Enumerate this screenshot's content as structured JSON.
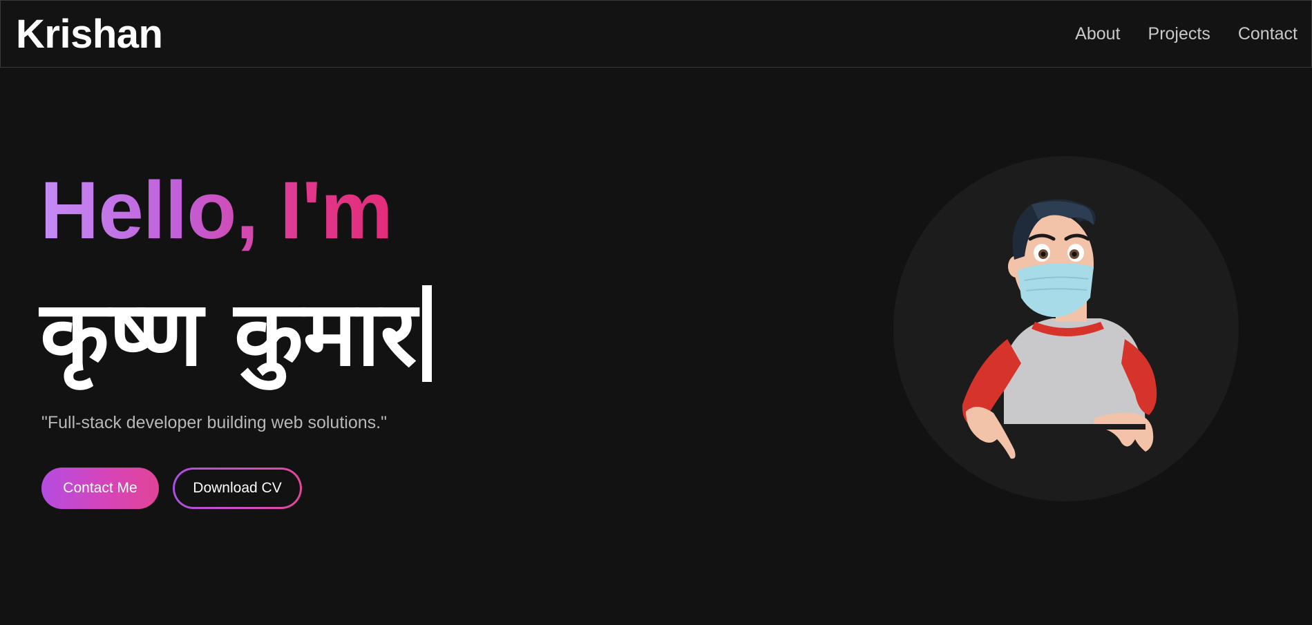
{
  "navbar": {
    "brand": "Krishan",
    "links": [
      {
        "label": "About"
      },
      {
        "label": "Projects"
      },
      {
        "label": "Contact"
      }
    ]
  },
  "hero": {
    "greeting": "Hello, I'm",
    "name": "कृष्ण कुमार",
    "tagline": "\"Full-stack developer building web solutions.\"",
    "primary_button": "Contact Me",
    "secondary_button": "Download CV",
    "avatar_icon": "cartoon-developer-avatar"
  },
  "colors": {
    "background": "#121212",
    "gradient_start": "#c48cf6",
    "gradient_end": "#e22d79"
  }
}
